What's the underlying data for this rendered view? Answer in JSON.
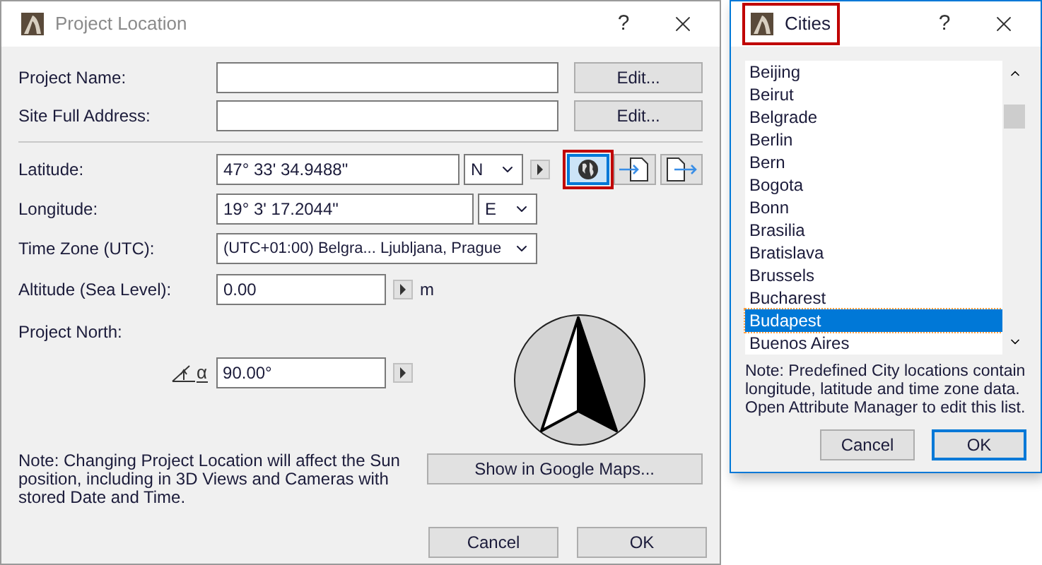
{
  "project_location": {
    "title": "Project Location",
    "help": "?",
    "project_name": {
      "label": "Project Name:",
      "button": "Edit..."
    },
    "site_address": {
      "label": "Site Full Address:",
      "button": "Edit..."
    },
    "latitude": {
      "label": "Latitude:",
      "value": "47° 33' 34.9488\"",
      "hemisphere": "N"
    },
    "longitude": {
      "label": "Longitude:",
      "value": "19° 3' 17.2044\"",
      "hemisphere": "E"
    },
    "tools": [
      {
        "kind": "globe",
        "highlighted": true
      },
      {
        "kind": "import",
        "highlighted": false
      },
      {
        "kind": "export",
        "highlighted": false
      }
    ],
    "time_zone": {
      "label": "Time Zone (UTC):",
      "value": "(UTC+01:00) Belgra... Ljubljana, Prague"
    },
    "altitude": {
      "label": "Altitude (Sea Level):",
      "value": "0.00",
      "unit": "m"
    },
    "project_north": {
      "label": "Project North:",
      "symbol": "α",
      "value": "90.00°"
    },
    "note": "Note: Changing Project Location will affect the Sun position, including in 3D Views and Cameras with stored Date and Time.",
    "map_button": "Show in Google Maps...",
    "buttons": [
      "Cancel",
      "OK"
    ]
  },
  "cities": {
    "title": "Cities",
    "title_highlighted": true,
    "help": "?",
    "items": [
      {
        "label": "Beijing",
        "selected": false
      },
      {
        "label": "Beirut",
        "selected": false
      },
      {
        "label": "Belgrade",
        "selected": false
      },
      {
        "label": "Berlin",
        "selected": false
      },
      {
        "label": "Bern",
        "selected": false
      },
      {
        "label": "Bogota",
        "selected": false
      },
      {
        "label": "Bonn",
        "selected": false
      },
      {
        "label": "Brasilia",
        "selected": false
      },
      {
        "label": "Bratislava",
        "selected": false
      },
      {
        "label": "Brussels",
        "selected": false
      },
      {
        "label": "Bucharest",
        "selected": false
      },
      {
        "label": "Budapest",
        "selected": true
      },
      {
        "label": "Buenos Aires",
        "selected": false
      }
    ],
    "note": "Note: Predefined City locations contain longitude, latitude and time zone data. Open Attribute Manager to edit this list.",
    "buttons": [
      {
        "label": "Cancel",
        "default": false
      },
      {
        "label": "OK",
        "default": true
      }
    ]
  }
}
